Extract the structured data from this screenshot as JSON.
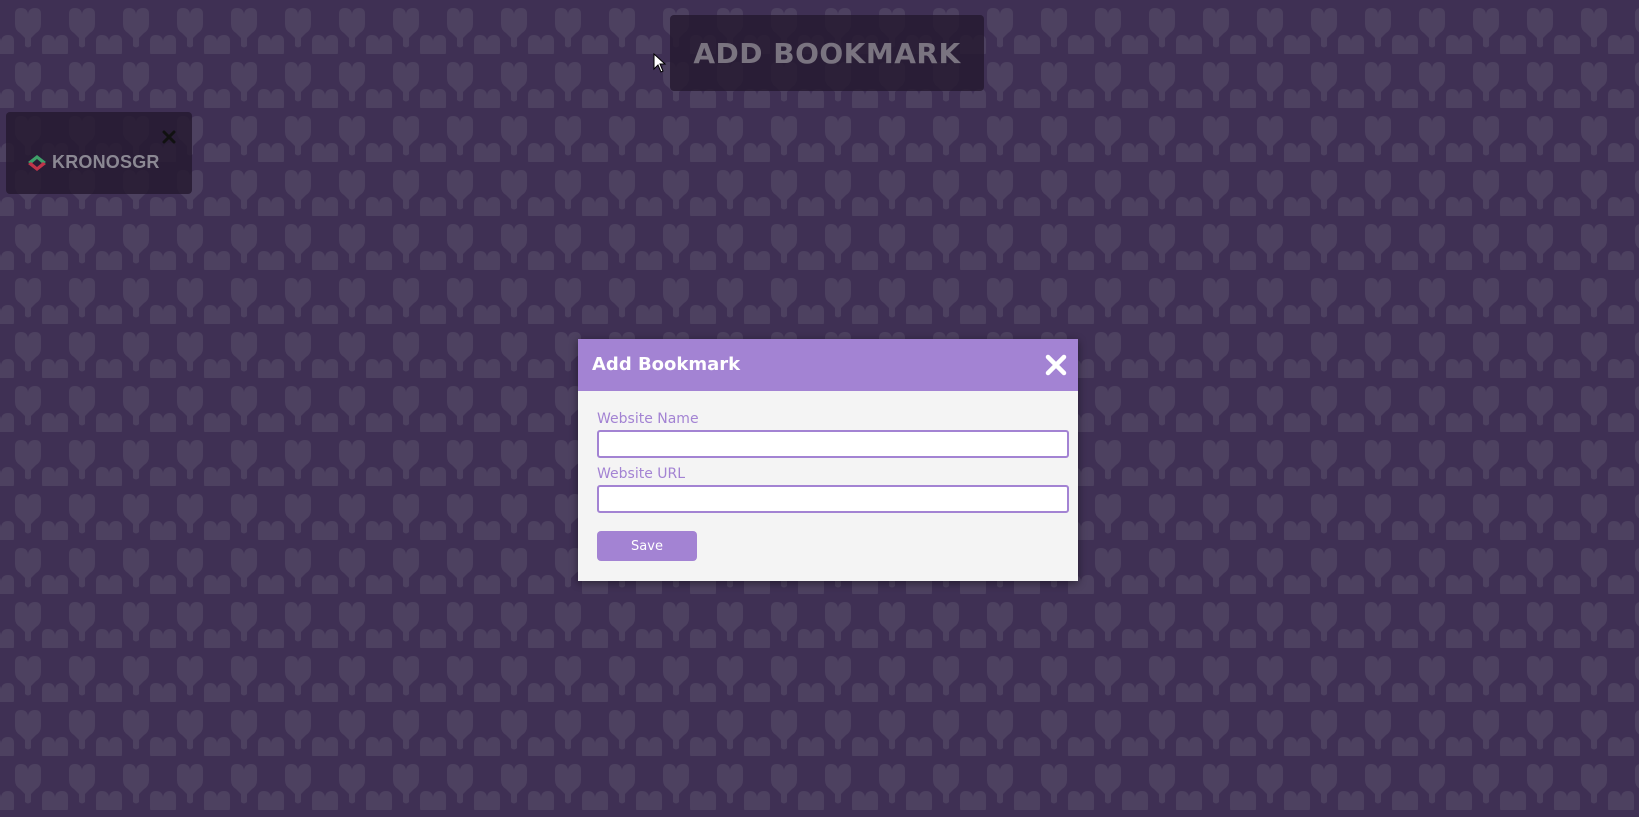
{
  "background": {
    "color": "#3f3054",
    "pattern_color": "#4d4160",
    "pattern_icon": "heart-shield-icon"
  },
  "toolbar": {
    "add_bookmark_label": "ADD BOOKMARK"
  },
  "bookmarks": [
    {
      "label": "KRONOSGR",
      "icon": "kronosgr-logo-icon",
      "close_icon": "close-icon"
    }
  ],
  "modal": {
    "title": "Add Bookmark",
    "close_icon": "close-icon",
    "fields": {
      "name": {
        "label": "Website Name",
        "value": "",
        "placeholder": ""
      },
      "url": {
        "label": "Website URL",
        "value": "",
        "placeholder": ""
      }
    },
    "save_label": "Save"
  },
  "colors": {
    "accent": "#a383d3",
    "modal_body": "#f4f4f4",
    "tile_bg": "#241a30"
  }
}
